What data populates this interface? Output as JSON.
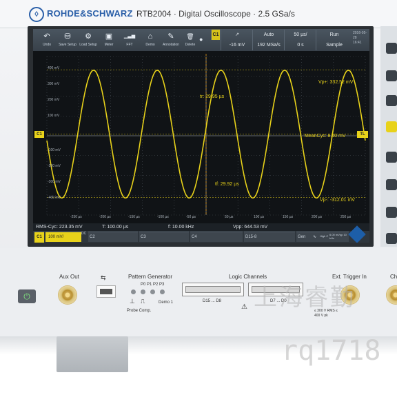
{
  "device": {
    "brand": "ROHDE&SCHWARZ",
    "model_title": "RTB2004 · Digital Oscilloscope · 2.5 GSa/s"
  },
  "toolbar": {
    "buttons": [
      {
        "label": "Undo",
        "icon": "undo-icon",
        "glyph": "↶"
      },
      {
        "label": "Save Setup",
        "icon": "save-setup-icon",
        "glyph": "⛁"
      },
      {
        "label": "Load Setup",
        "icon": "load-setup-icon",
        "glyph": "⚙"
      },
      {
        "label": "Meter",
        "icon": "meter-icon",
        "glyph": "▣"
      },
      {
        "label": "FFT",
        "icon": "fft-icon",
        "glyph": "▁▃▅"
      },
      {
        "label": "Demo",
        "icon": "demo-icon",
        "glyph": "⌂"
      },
      {
        "label": "Annotation",
        "icon": "annotation-icon",
        "glyph": "✎"
      },
      {
        "label": "Delete",
        "icon": "delete-icon",
        "glyph": "🗑"
      }
    ],
    "trigger": {
      "source": "C1",
      "slope": "↗",
      "level": "-16 mV",
      "mode": "Auto",
      "sample_rate": "192 MSa/s",
      "timebase": "50 µs/",
      "position": "0 s",
      "run_state": "Run",
      "acquisition": "Sample",
      "date": "2016-05-28",
      "time": "16:41"
    }
  },
  "graticule": {
    "y_labels": [
      "400 mV",
      "300 mV",
      "200 mV",
      "100 mV",
      "-100 mV",
      "-200 mV",
      "-300 mV",
      "-400 mV"
    ],
    "x_labels": [
      "-250 µs",
      "-200 µs",
      "-150 µs",
      "-100 µs",
      "-50 µs",
      "50 µs",
      "100 µs",
      "150 µs",
      "200 µs",
      "250 µs"
    ],
    "left_marker": "C1",
    "right_marker": "TL"
  },
  "measurements": {
    "vp_plus": "Vp+: 332.52 mV",
    "mean_cyc": "MeanCyc: 8.40 mV",
    "vp_minus": "Vp-: -312.01 mV",
    "rise_time": "tr: 29.95 µs",
    "fall_time": "tf: 29.92 µs"
  },
  "info_bar": {
    "rms_cyc": "RMS-Cyc: 223.35 mV",
    "period": "T: 100.00 µs",
    "frequency": "f: 10.00 kHz",
    "vpp": "Vpp: 644.53 mV"
  },
  "channels": {
    "c1_label": "C1",
    "c1_scale": "100 mV/",
    "c1_coupling": "DC",
    "c2_label": "C2",
    "c3_label": "C3",
    "c4_label": "C4",
    "digital_label": "D15-8",
    "gen_label": "Gen",
    "gen_impedance": "High Z",
    "gen_info": "6.00 mVpp 10 kHz"
  },
  "front_panel": {
    "aux_out": "Aux Out",
    "pattern_generator": "Pattern Generator",
    "pattern_pins": "P0  P1  P2  P3",
    "probe_comp": "Probe Comp.",
    "demo_label": "Demo 1",
    "logic_channels": "Logic Channels",
    "logic_d15_d8": "D15 ... D8",
    "logic_d7_d0": "D7 ... D0",
    "ext_trigger": "Ext. Trigger In",
    "rating": "≤ 300 V RMS ≤ 400 V pk",
    "ch_partial": "Ch"
  },
  "watermark": {
    "line1": "上海睿勤",
    "line2": "rq1718"
  },
  "colors": {
    "trace": "#e8d21a",
    "screen_bg": "#101316",
    "toolbar": "#434d57",
    "brand_blue": "#2a5fa8",
    "bezel": "#2b2f33"
  },
  "chart_data": {
    "type": "line",
    "series": [
      {
        "name": "C1",
        "frequency_hz": 10000,
        "amplitude_mv": 322.3,
        "offset_mv": 8.4
      }
    ],
    "x_range_us": [
      -250,
      250
    ],
    "y_range_mv": [
      -400,
      400
    ]
  }
}
